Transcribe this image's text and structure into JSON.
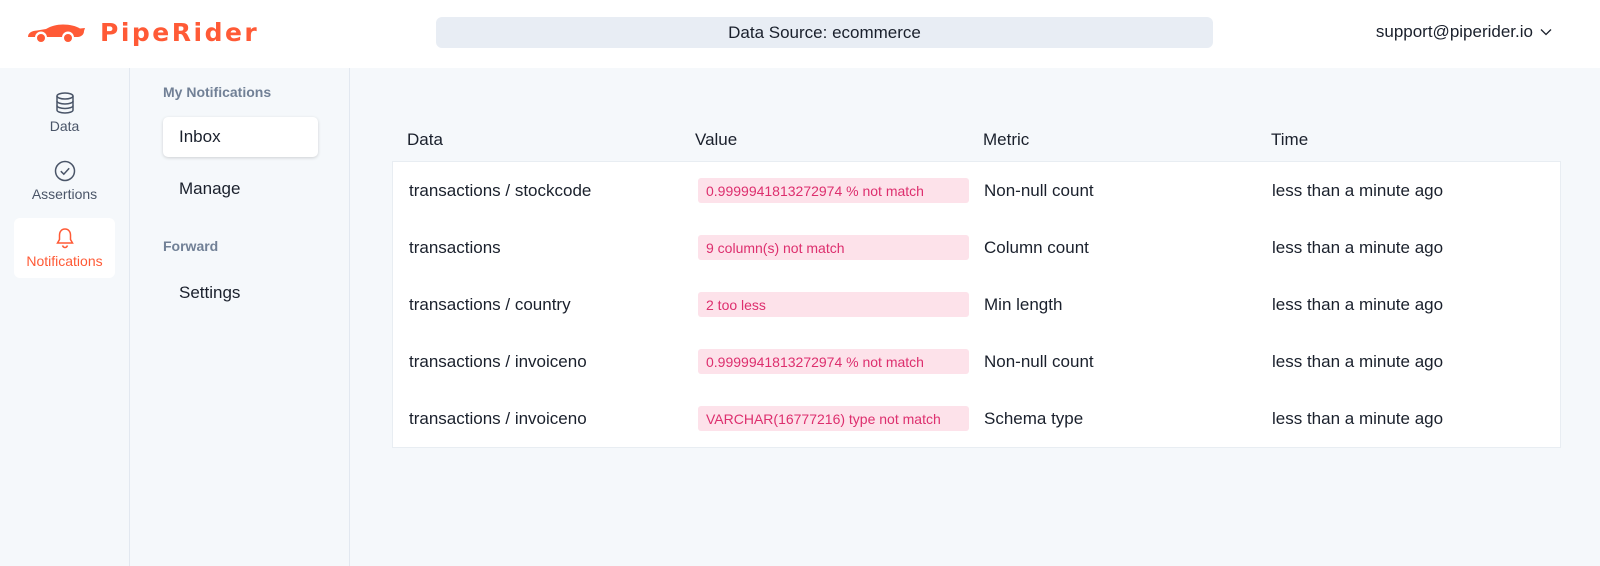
{
  "brand": {
    "name": "PipeRider",
    "color": "#ff5a36",
    "icon": "car-logo-icon"
  },
  "header": {
    "data_source": "Data Source: ecommerce",
    "user_email": "support@piperider.io",
    "user_menu_icon": "chevron-down-icon"
  },
  "rail": {
    "items": [
      {
        "label": "Data",
        "icon": "database-icon",
        "active": false
      },
      {
        "label": "Assertions",
        "icon": "check-circle-icon",
        "active": false
      },
      {
        "label": "Notifications",
        "icon": "bell-icon",
        "active": true
      }
    ]
  },
  "subnav": {
    "sections": [
      {
        "heading": "My Notifications",
        "items": [
          {
            "label": "Inbox",
            "active": true
          },
          {
            "label": "Manage",
            "active": false
          }
        ]
      },
      {
        "heading": "Forward",
        "items": [
          {
            "label": "Settings",
            "active": false
          }
        ]
      }
    ]
  },
  "table": {
    "columns": [
      "Data",
      "Value",
      "Metric",
      "Time"
    ],
    "rows": [
      {
        "data": "transactions / stockcode",
        "value": "0.9999941813272974 % not match",
        "metric": "Non-null count",
        "time": "less than a minute ago"
      },
      {
        "data": "transactions",
        "value": "9 column(s) not match",
        "metric": "Column count",
        "time": "less than a minute ago"
      },
      {
        "data": "transactions / country",
        "value": "2 too less",
        "metric": "Min length",
        "time": "less than a minute ago"
      },
      {
        "data": "transactions / invoiceno",
        "value": "0.9999941813272974 % not match",
        "metric": "Non-null count",
        "time": "less than a minute ago"
      },
      {
        "data": "transactions / invoiceno",
        "value": "VARCHAR(16777216) type not match",
        "metric": "Schema type",
        "time": "less than a minute ago"
      }
    ]
  },
  "colors": {
    "accent": "#ff5a36",
    "badge_bg": "#fde2ea",
    "badge_text": "#dd2f6e",
    "background": "#f5f8fb"
  }
}
